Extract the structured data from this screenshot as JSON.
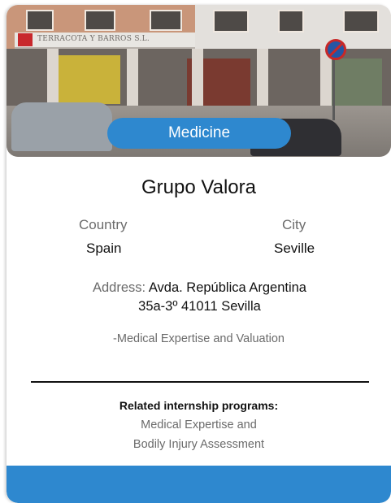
{
  "photo": {
    "alt": "Building facade",
    "sign_text": "TERRACOTA Y BARROS S.L."
  },
  "category": "Medicine",
  "title": "Grupo Valora",
  "location": {
    "country_label": "Country",
    "country_value": "Spain",
    "city_label": "City",
    "city_value": "Seville"
  },
  "address": {
    "label": "Address:",
    "line1": "Avda. República Argentina",
    "line2": "35a-3º 41011 Sevilla"
  },
  "specialty": "-Medical Expertise and Valuation",
  "related": {
    "heading": "Related internship programs:",
    "program_line1": "Medical Expertise and",
    "program_line2": "Bodily Injury Assessment"
  },
  "colors": {
    "accent": "#2e88cf",
    "text": "#111111",
    "muted": "#6b6b6b"
  }
}
